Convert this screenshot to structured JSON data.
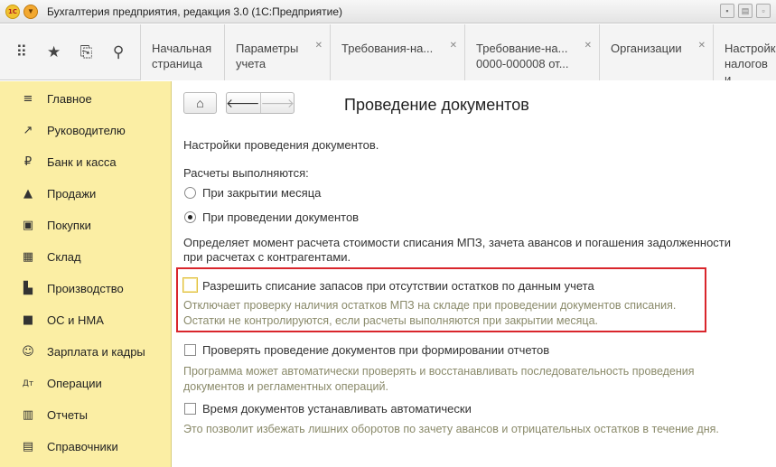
{
  "window": {
    "title": "Бухгалтерия предприятия, редакция 3.0  (1С:Предприятие)",
    "logo_text": "1C"
  },
  "tabs": [
    {
      "line1": "Начальная",
      "line2": "страница",
      "closable": false
    },
    {
      "line1": "Параметры",
      "line2": "учета",
      "closable": true
    },
    {
      "line1": "Требования-на...",
      "line2": "",
      "closable": true
    },
    {
      "line1": "Требование-на...",
      "line2": "0000-000008 от...",
      "closable": true
    },
    {
      "line1": "Организации",
      "line2": "",
      "closable": true
    },
    {
      "line1": "Настройк",
      "line2": "налогов и",
      "closable": false
    }
  ],
  "sidebar": {
    "items": [
      {
        "label": "Главное",
        "icon": "≡"
      },
      {
        "label": "Руководителю",
        "icon": "↗"
      },
      {
        "label": "Банк и касса",
        "icon": "₽"
      },
      {
        "label": "Продажи",
        "icon": "▲"
      },
      {
        "label": "Покупки",
        "icon": "▣"
      },
      {
        "label": "Склад",
        "icon": "▦"
      },
      {
        "label": "Производство",
        "icon": "▙"
      },
      {
        "label": "ОС и НМА",
        "icon": "■"
      },
      {
        "label": "Зарплата и кадры",
        "icon": "☺"
      },
      {
        "label": "Операции",
        "icon": "Дт"
      },
      {
        "label": "Отчеты",
        "icon": "▥"
      },
      {
        "label": "Справочники",
        "icon": "▤"
      }
    ]
  },
  "main": {
    "title": "Проведение документов",
    "settings_label": "Настройки проведения документов.",
    "calc_label": "Расчеты выполняются:",
    "radio_month_close": "При закрытии месяца",
    "radio_doc_post": "При проведении документов",
    "calc_hint_1": "Определяет момент расчета стоимости списания МПЗ, зачета авансов и погашения задолженности",
    "calc_hint_2": "при расчетах с контрагентами.",
    "allow_writeoff_label": "Разрешить списание запасов при отсутствии остатков по данным учета",
    "allow_writeoff_hint_1": "Отключает проверку наличия остатков МПЗ на складе при проведении документов списания.",
    "allow_writeoff_hint_2": "Остатки не контролируются, если расчеты выполняются при закрытии месяца.",
    "check_posting_label": "Проверять проведение документов при формировании отчетов",
    "check_posting_hint_1": "Программа может автоматически проверять и восстанавливать последовательность проведения",
    "check_posting_hint_2": "документов и регламентных операций.",
    "auto_time_label": "Время документов устанавливать автоматически",
    "auto_time_hint": "Это позволит избежать лишних оборотов по зачету авансов и отрицательных остатков в течение дня."
  }
}
